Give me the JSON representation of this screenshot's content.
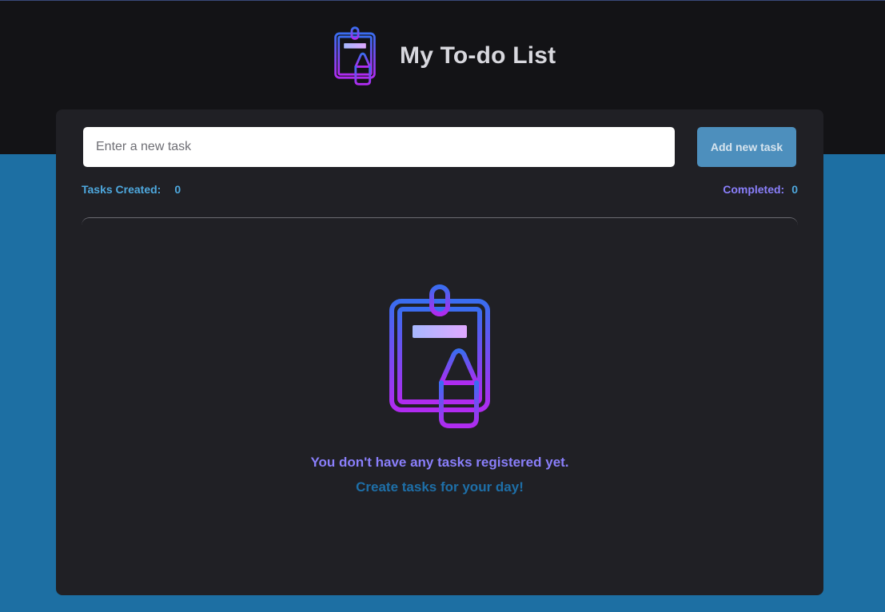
{
  "app": {
    "title": "My To-do List",
    "logo_icon": "clipboard-pencil-icon"
  },
  "task_form": {
    "input_value": "",
    "input_placeholder": "Enter a new task",
    "add_button_label": "Add new task"
  },
  "counters": {
    "created_label": "Tasks Created:",
    "created_count": "0",
    "completed_label": "Completed:",
    "completed_count": "0"
  },
  "empty_state": {
    "icon": "clipboard-pencil-icon",
    "title": "You don't have any tasks registered yet.",
    "subtitle": "Create tasks for your day!"
  },
  "colors": {
    "header_bg": "#131316",
    "page_bg": "#1d6fa3",
    "card_bg": "#202025",
    "accent_blue": "#4ea8de",
    "accent_purple": "#8a7ffb",
    "button_bg": "#4d8fbd",
    "gradient_start": "#3a6df0",
    "gradient_end": "#b02bf0"
  }
}
